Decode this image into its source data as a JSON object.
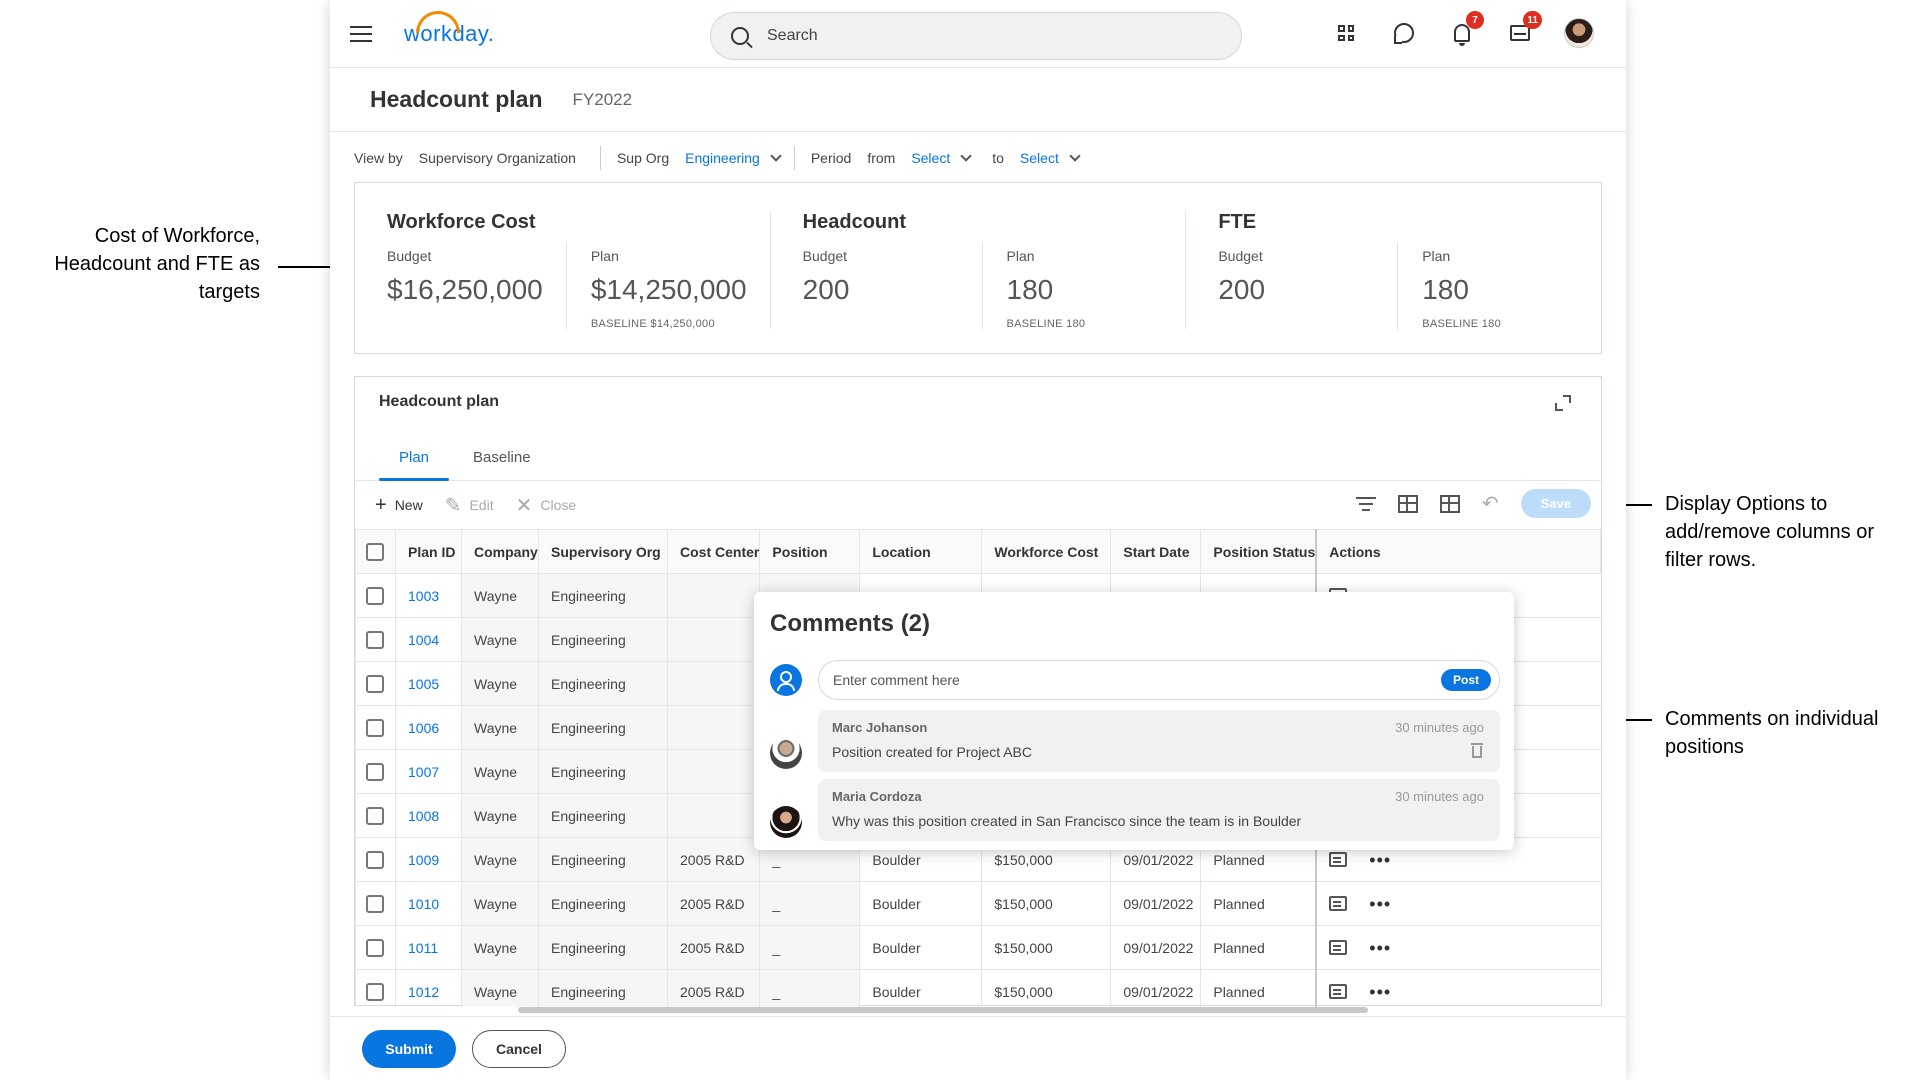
{
  "annotations": {
    "left": "Cost of Workforce, Headcount and FTE as targets",
    "display_options": "Display Options to add/remove columns or filter rows.",
    "comments": "Comments on individual positions"
  },
  "header": {
    "logo": "workday.",
    "search_placeholder": "Search",
    "notifications_badge": "7",
    "inbox_badge": "11"
  },
  "page": {
    "title": "Headcount plan",
    "subtitle": "FY2022"
  },
  "filters": {
    "view_by_label": "View by",
    "view_by_value": "Supervisory Organization",
    "sup_org_label": "Sup Org",
    "sup_org_value": "Engineering",
    "period_label": "Period",
    "from_label": "from",
    "from_value": "Select",
    "to_label": "to",
    "to_value": "Select"
  },
  "kpis": [
    {
      "title": "Workforce Cost",
      "budget_label": "Budget",
      "budget": "$16,250,000",
      "plan_label": "Plan",
      "plan": "$14,250,000",
      "baseline": "BASELINE $14,250,000"
    },
    {
      "title": "Headcount",
      "budget_label": "Budget",
      "budget": "200",
      "plan_label": "Plan",
      "plan": "180",
      "baseline": "BASELINE 180"
    },
    {
      "title": "FTE",
      "budget_label": "Budget",
      "budget": "200",
      "plan_label": "Plan",
      "plan": "180",
      "baseline": "BASELINE 180"
    }
  ],
  "panel": {
    "title": "Headcount plan",
    "tabs": [
      "Plan",
      "Baseline"
    ],
    "toolbar": {
      "new": "New",
      "edit": "Edit",
      "close": "Close",
      "save": "Save"
    }
  },
  "table": {
    "columns": [
      "Plan ID",
      "Company",
      "Supervisory  Org",
      "Cost Center",
      "Position",
      "Location",
      "Workforce Cost",
      "Start Date",
      "Position Status",
      "Actions"
    ],
    "rows": [
      {
        "id": "1003",
        "company": "Wayne",
        "org": "Engineering",
        "cost_center": "",
        "position": "",
        "location": "",
        "cost": "",
        "start": "",
        "status": ""
      },
      {
        "id": "1004",
        "company": "Wayne",
        "org": "Engineering",
        "cost_center": "",
        "position": "",
        "location": "",
        "cost": "",
        "start": "",
        "status": ""
      },
      {
        "id": "1005",
        "company": "Wayne",
        "org": "Engineering",
        "cost_center": "",
        "position": "",
        "location": "",
        "cost": "",
        "start": "",
        "status": ""
      },
      {
        "id": "1006",
        "company": "Wayne",
        "org": "Engineering",
        "cost_center": "",
        "position": "",
        "location": "",
        "cost": "",
        "start": "",
        "status": ""
      },
      {
        "id": "1007",
        "company": "Wayne",
        "org": "Engineering",
        "cost_center": "",
        "position": "",
        "location": "",
        "cost": "",
        "start": "",
        "status": ""
      },
      {
        "id": "1008",
        "company": "Wayne",
        "org": "Engineering",
        "cost_center": "",
        "position": "",
        "location": "",
        "cost": "",
        "start": "",
        "status": ""
      },
      {
        "id": "1009",
        "company": "Wayne",
        "org": "Engineering",
        "cost_center": "2005 R&D",
        "position": "_",
        "location": "Boulder",
        "cost": "$150,000",
        "start": "09/01/2022",
        "status": "Planned"
      },
      {
        "id": "1010",
        "company": "Wayne",
        "org": "Engineering",
        "cost_center": "2005 R&D",
        "position": "_",
        "location": "Boulder",
        "cost": "$150,000",
        "start": "09/01/2022",
        "status": "Planned"
      },
      {
        "id": "1011",
        "company": "Wayne",
        "org": "Engineering",
        "cost_center": "2005 R&D",
        "position": "_",
        "location": "Boulder",
        "cost": "$150,000",
        "start": "09/01/2022",
        "status": "Planned"
      },
      {
        "id": "1012",
        "company": "Wayne",
        "org": "Engineering",
        "cost_center": "2005 R&D",
        "position": "_",
        "location": "Boulder",
        "cost": "$150,000",
        "start": "09/01/2022",
        "status": "Planned"
      }
    ]
  },
  "comments": {
    "title": "Comments (2)",
    "input_placeholder": "Enter comment here",
    "post_label": "Post",
    "items": [
      {
        "author": "Marc Johanson",
        "time": "30 minutes ago",
        "text": "Position created for Project ABC"
      },
      {
        "author": "Maria Cordoza",
        "time": "30 minutes ago",
        "text": "Why was this position created in San Francisco since the team is in Boulder"
      }
    ]
  },
  "footer": {
    "submit": "Submit",
    "cancel": "Cancel"
  },
  "colors": {
    "accent": "#0875e1",
    "badge": "#de2e21",
    "logo_arc": "#f38b00"
  }
}
